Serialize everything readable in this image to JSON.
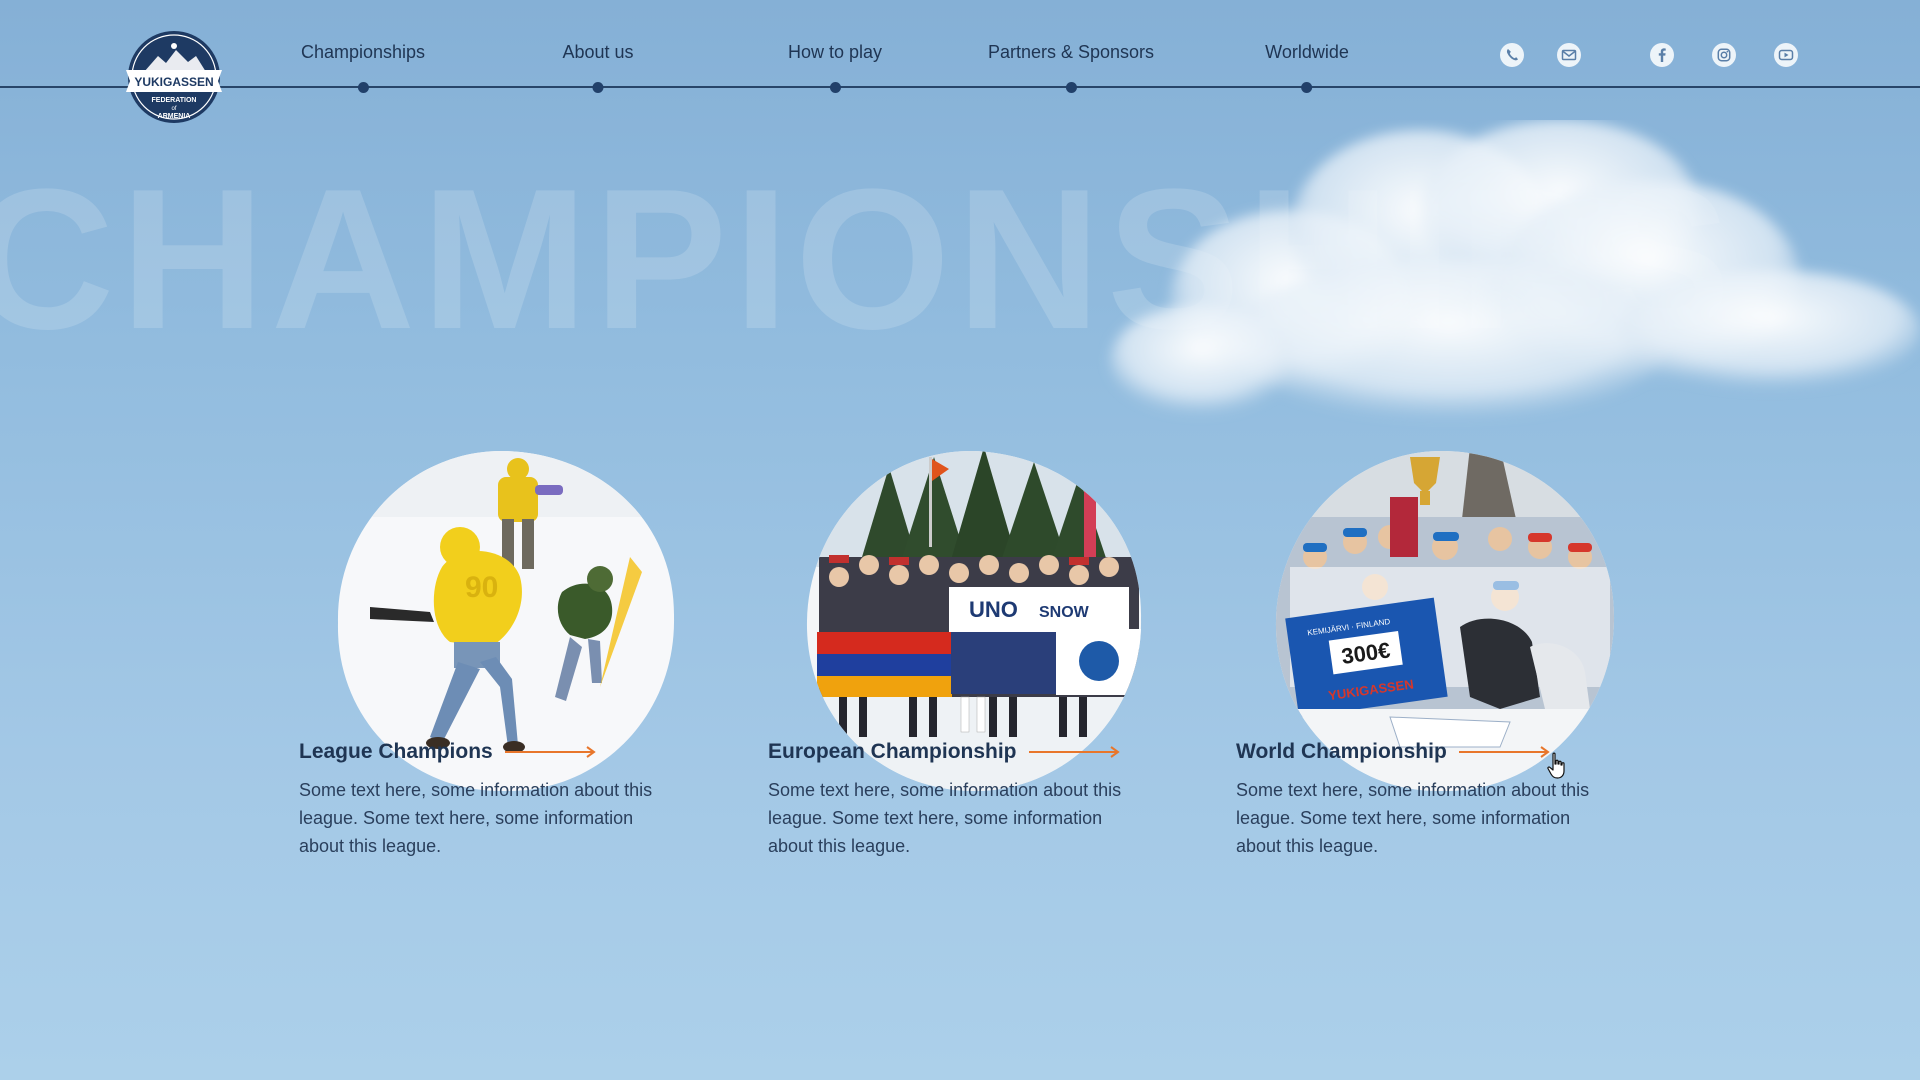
{
  "logo": {
    "line1": "YUKIGASSEN",
    "line2": "FEDERATION",
    "line3": "of",
    "line4": "ARMENIA"
  },
  "nav": {
    "items": [
      {
        "label": "Championships"
      },
      {
        "label": "About us"
      },
      {
        "label": "How to play"
      },
      {
        "label": "Partners & Sponsors"
      },
      {
        "label": "Worldwide"
      }
    ]
  },
  "header_icons": [
    "phone-icon",
    "mail-icon",
    "facebook-icon",
    "instagram-icon",
    "youtube-icon"
  ],
  "hero": {
    "background_word": "CHAMPIONSHIPS"
  },
  "cards": [
    {
      "title": "League Champions",
      "text": "Some text here, some information about this league. Some text here, some information about this league.",
      "photo": "snowball-players-photo"
    },
    {
      "title": "European Championship",
      "text": "Some text here, some information about this league. Some text here, some information about this league.",
      "photo": "team-with-flags-photo",
      "photo_text": [
        "UNO",
        "SNOW"
      ]
    },
    {
      "title": "World Championship",
      "text": "Some text here, some information about this league. Some text here, some information about this league.",
      "photo": "winning-team-photo",
      "photo_text": [
        "KEMIJÄRVI · FINLAND",
        "300€",
        "YUKIGASSEN"
      ]
    }
  ],
  "colors": {
    "navy": "#1f3553",
    "accent_arrow": "#e8762b",
    "sky_top": "#85b0d6",
    "sky_bottom": "#acd0ea"
  }
}
